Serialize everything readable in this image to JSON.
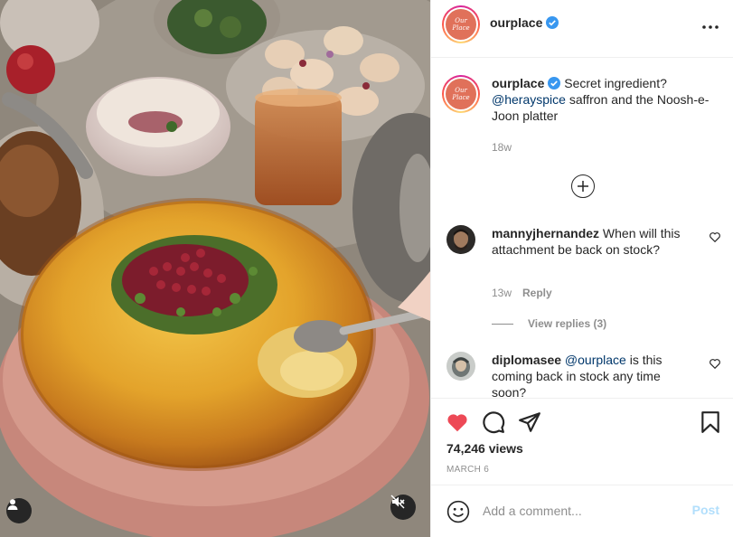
{
  "post": {
    "username": "ourplace",
    "avatar_text": "Our Place",
    "verified": true
  },
  "caption": {
    "username": "ourplace",
    "text_before": "Secret ingredient?",
    "mention": "@herayspice",
    "text_after": "saffron and the Noosh-e-Joon platter",
    "time": "18w"
  },
  "comments": [
    {
      "username": "mannyjhernandez",
      "text": "When will this attachment be back on stock?",
      "time": "13w",
      "reply_label": "Reply",
      "view_replies": "View replies (3)"
    },
    {
      "username": "diplomasee",
      "mention": "@ourplace",
      "text": "is this coming back in stock any time soon?"
    }
  ],
  "stats": {
    "views": "74,246 views",
    "date": "MARCH 6",
    "liked": true
  },
  "composer": {
    "placeholder": "Add a comment...",
    "post_label": "Post"
  },
  "colors": {
    "like_red": "#ed4956",
    "verified_blue": "#3897f0",
    "link_blue": "#00376b",
    "post_disabled": "#b2dffc"
  }
}
